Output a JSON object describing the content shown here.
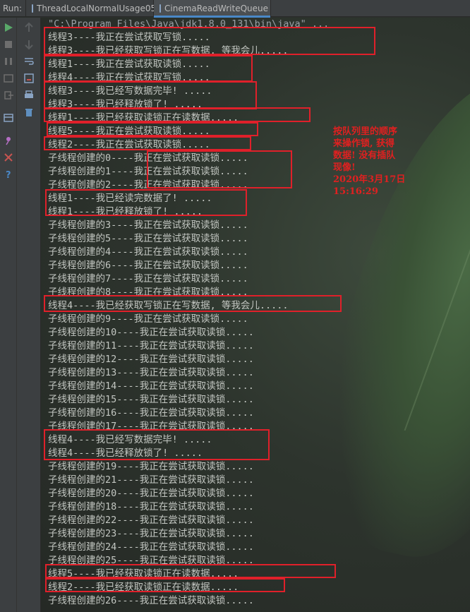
{
  "tabbar": {
    "run_label": "Run:",
    "tabs": [
      {
        "label": "ThreadLocalNormalUsage05"
      },
      {
        "label": "CinemaReadWriteQueue"
      }
    ]
  },
  "console": {
    "lines": [
      "\"C:\\Program Files\\Java\\jdk1.8.0_131\\bin\\java\" ...",
      "线程3----我正在尝试获取写锁.....",
      "线程3----我已经获取写锁正在写数据, 等我会儿.....",
      "线程1----我正在尝试获取读锁.....",
      "线程4----我正在尝试获取写锁.....",
      "线程3----我已经写数据完毕! .....",
      "线程3----我已经释放锁了! .....",
      "线程1----我已经获取读锁正在读数据.....",
      "线程5----我正在尝试获取读锁.....",
      "线程2----我正在尝试获取读锁.....",
      "子线程创建的0----我正在尝试获取读锁.....",
      "子线程创建的1----我正在尝试获取读锁.....",
      "子线程创建的2----我正在尝试获取读锁.....",
      "线程1----我已经读完数据了! .....",
      "线程1----我已经释放锁了! .....",
      "子线程创建的3----我正在尝试获取读锁.....",
      "子线程创建的5----我正在尝试获取读锁.....",
      "子线程创建的4----我正在尝试获取读锁.....",
      "子线程创建的6----我正在尝试获取读锁.....",
      "子线程创建的7----我正在尝试获取读锁.....",
      "子线程创建的8----我正在尝试获取读锁.....",
      "线程4----我已经获取写锁正在写数据, 等我会儿.....",
      "子线程创建的9----我正在尝试获取读锁.....",
      "子线程创建的10----我正在尝试获取读锁.....",
      "子线程创建的11----我正在尝试获取读锁.....",
      "子线程创建的12----我正在尝试获取读锁.....",
      "子线程创建的13----我正在尝试获取读锁.....",
      "子线程创建的14----我正在尝试获取读锁.....",
      "子线程创建的15----我正在尝试获取读锁.....",
      "子线程创建的16----我正在尝试获取读锁.....",
      "子线程创建的17----我正在尝试获取读锁.....",
      "线程4----我已经写数据完毕! .....",
      "线程4----我已经释放锁了! .....",
      "子线程创建的19----我正在尝试获取读锁.....",
      "子线程创建的21----我正在尝试获取读锁.....",
      "子线程创建的20----我正在尝试获取读锁.....",
      "子线程创建的18----我正在尝试获取读锁.....",
      "子线程创建的22----我正在尝试获取读锁.....",
      "子线程创建的23----我正在尝试获取读锁.....",
      "子线程创建的24----我正在尝试获取读锁.....",
      "子线程创建的25----我正在尝试获取读锁.....",
      "线程5----我已经获取读锁正在读数据.....",
      "线程2----我已经获取读锁正在读数据.....",
      "子线程创建的26----我正在尝试获取读锁....."
    ],
    "annotation": {
      "text": "按队列里的顺序\n来操作锁, 获得\n数据! 没有插队\n现像!\n2020年3月17日\n15:16:29",
      "color": "#e02020"
    }
  },
  "colors": {
    "highlight_box": "#e0202a",
    "active_tab_underline": "#4a88c7"
  }
}
